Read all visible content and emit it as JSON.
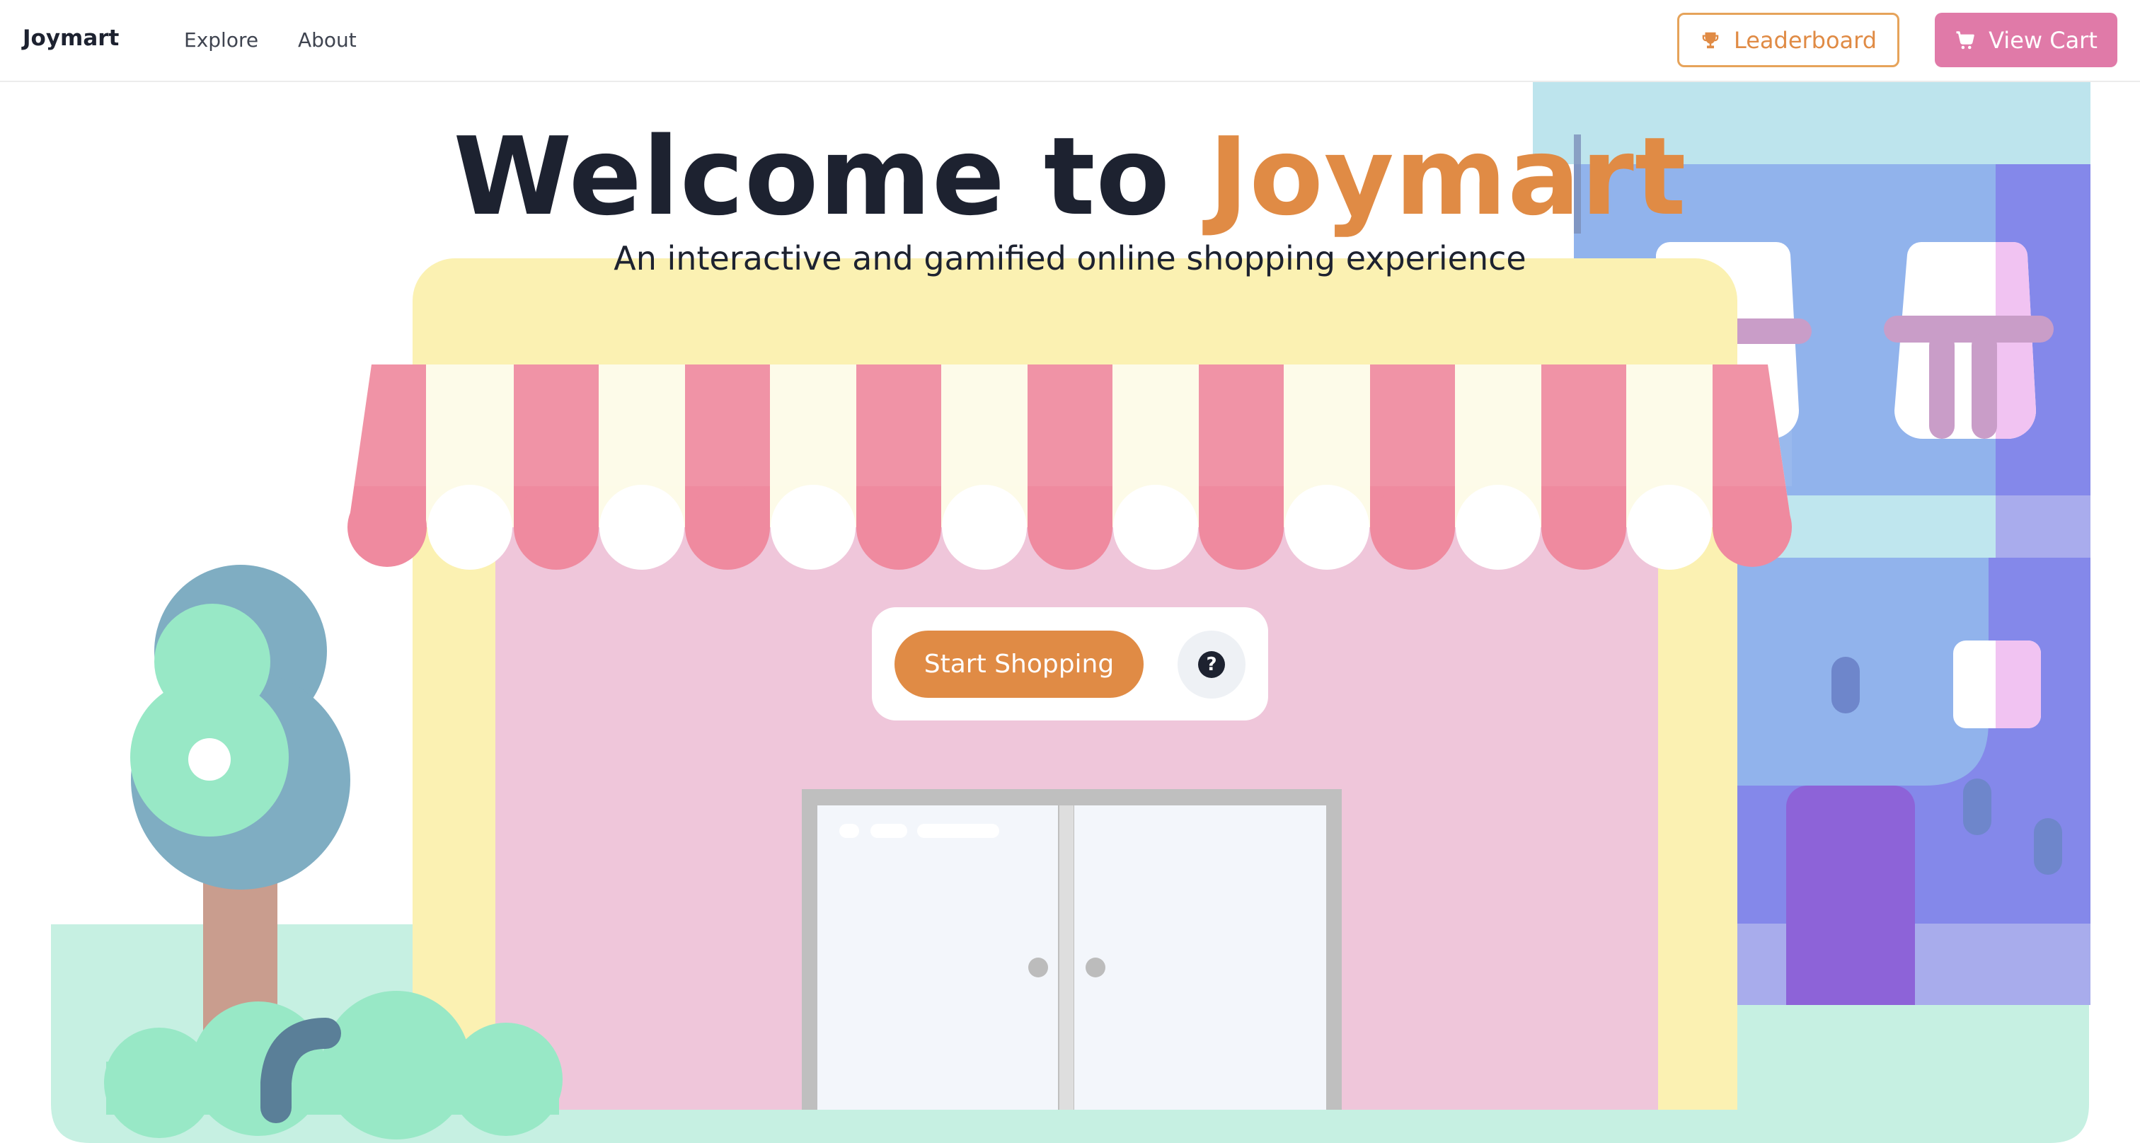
{
  "navbar": {
    "brand": "Joymart",
    "links": [
      "Explore",
      "About"
    ],
    "leaderboard_label": "Leaderboard",
    "cart_label": "View Cart"
  },
  "hero": {
    "title_prefix": "Welcome to ",
    "title_accent": "Joymart",
    "subtitle": "An interactive and gamified online shopping experience"
  },
  "cta": {
    "start_label": "Start Shopping",
    "help_label": "?"
  },
  "icons": {
    "leaderboard": "trophy-icon",
    "cart": "cart-icon",
    "help": "question-circle-icon"
  },
  "colors": {
    "accent": "#e08b45",
    "cart_button": "#e07aa8",
    "text_dark": "#1d2230"
  }
}
